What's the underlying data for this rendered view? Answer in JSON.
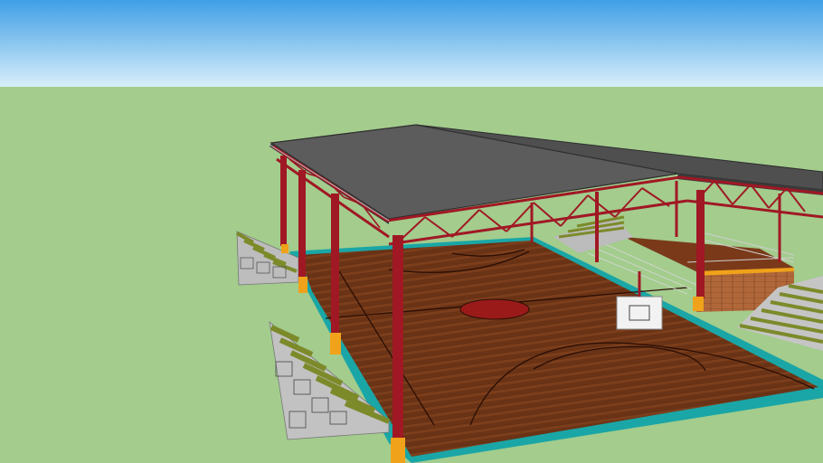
{
  "scene": {
    "description_visible_text": "",
    "colors": {
      "sky_top": "#3f9fe6",
      "sky_bottom": "#d8eefa",
      "ground": "#a3cc8d",
      "roof": "#5c5c5c",
      "roof_edge": "#2e2e2e",
      "steel": "#a01824",
      "steel_dark": "#6e0f17",
      "floor": "#6a3316",
      "floor_light": "#8a4a22",
      "court_line": "#2a0e05",
      "center_circle": "#9a1a1a",
      "curb": "#1aa6a6",
      "footing": "#f0a21a",
      "bleacher_seat": "#7d8a2a",
      "bleacher_frame": "#b8b8b8",
      "brick": "#b0683a",
      "stage_floor": "#7a3a1a"
    },
    "icons": [
      "roof-icon",
      "truss-icon",
      "bleacher-icon",
      "basketball-hoop-icon"
    ]
  }
}
